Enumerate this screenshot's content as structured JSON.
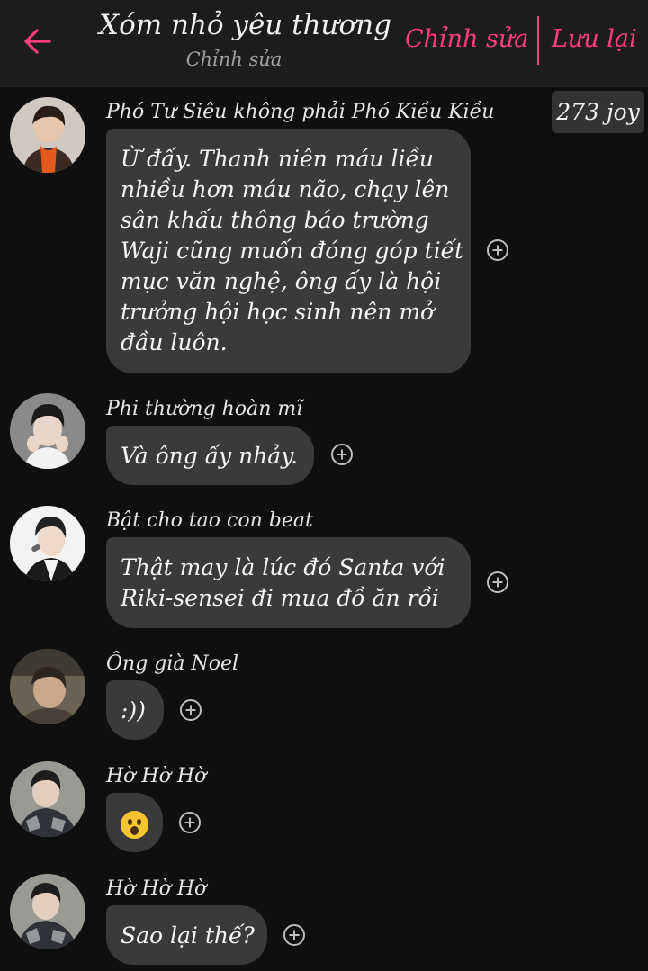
{
  "header": {
    "title": "Xóm nhỏ yêu thương",
    "subtitle": "Chỉnh sửa",
    "edit_label": "Chỉnh sửa",
    "save_label": "Lưu lại",
    "accent_color": "#ff3d7f"
  },
  "joy_badge": "273 joy",
  "icons": {
    "back": "arrow-left-icon",
    "react": "plus-circle-icon",
    "emoji": "hushed-face-emoji"
  },
  "messages": [
    {
      "sender": "Phó Tư Siêu không phải Phó Kiều Kiều",
      "lines": [
        "Ừ đấy. Thanh niên máu liều",
        "nhiều hơn máu não, chạy lên",
        "sân khấu thông báo trường",
        "Waji cũng muốn đóng góp tiết",
        "mục văn nghệ, ông ấy là hội",
        "trưởng hội học sinh nên mở",
        "đầu luôn."
      ]
    },
    {
      "sender": "Phi thường hoàn mĩ",
      "lines": [
        "Và ông ấy nhảy."
      ]
    },
    {
      "sender": "Bật cho tao con beat",
      "lines": [
        "Thật may là lúc đó Santa với",
        "Riki-sensei đi mua đồ ăn rồi"
      ]
    },
    {
      "sender": "Ông già Noel",
      "lines": [
        ":))"
      ]
    },
    {
      "sender": "Hờ Hờ Hờ",
      "lines": []
    },
    {
      "sender": "Hờ Hờ Hờ",
      "lines": [
        "Sao lại thế?"
      ]
    }
  ]
}
